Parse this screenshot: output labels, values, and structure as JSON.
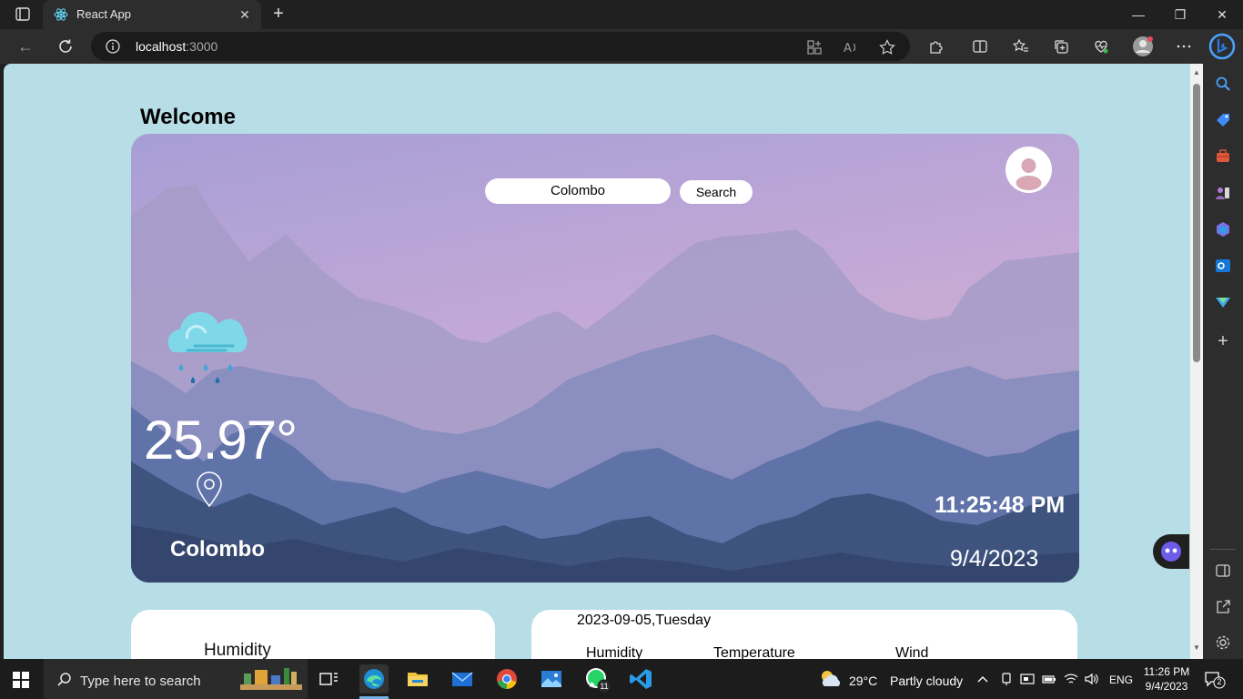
{
  "browser": {
    "tab_title": "React App",
    "url_host": "localhost",
    "url_port": ":3000"
  },
  "page": {
    "welcome": "Welcome",
    "search": {
      "value": "Colombo",
      "button_label": "Search"
    },
    "weather": {
      "icon": "rain-cloud-icon",
      "temperature": "25.97°",
      "city": "Colombo",
      "time": "11:25:48 PM",
      "date": "9/4/2023"
    },
    "left_card": {
      "label": "Humidity"
    },
    "forecast": {
      "date": "2023-09-05,Tuesday",
      "columns": [
        "Humidity",
        "Temperature",
        "Wind"
      ]
    }
  },
  "taskbar": {
    "search_placeholder": "Type here to search",
    "weather_temp": "29°C",
    "weather_desc": "Partly cloudy",
    "language": "ENG",
    "clock_time": "11:26 PM",
    "clock_date": "9/4/2023",
    "notification_count": "2",
    "whatsapp_badge": "11"
  }
}
